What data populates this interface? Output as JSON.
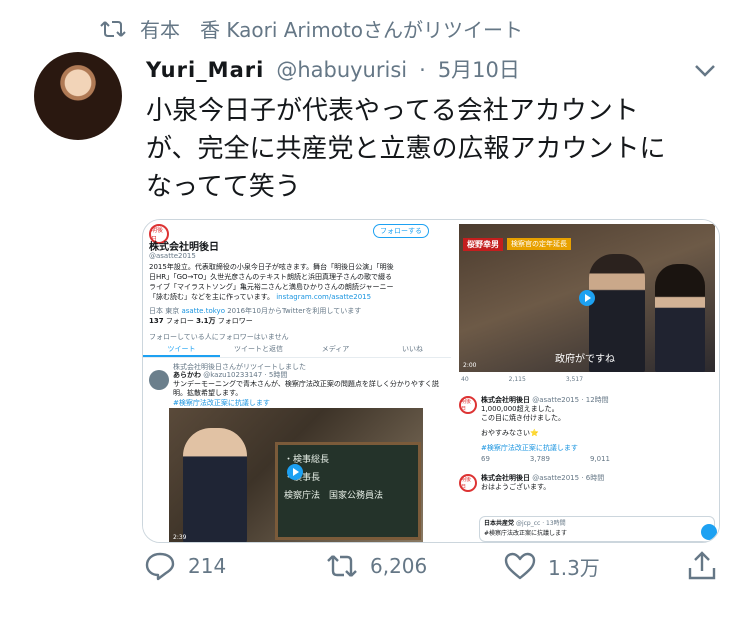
{
  "retweeted_by": "有本　香  Kaori Arimotoさんがリツイート",
  "author": {
    "display_name": "Yuri_Mari",
    "handle": "@habuyurisi",
    "separator": "·",
    "date": "5月10日"
  },
  "tweet_text": "小泉今日子が代表やってる会社アカウント\nが、完全に共産党と立憲の広報アカウントに\nなってて笑う",
  "media": {
    "left": {
      "logo_text": "明後日",
      "follow_label": "フォローする",
      "company_name": "株式会社明後日",
      "company_handle": "@asatte2015",
      "bio": "2015年設立。代表取締役の小泉今日子が呟きます。舞台「明後日公演」「明後日HR」「GO→TO」久世光彦さんのテキスト朗読と浜田真理子さんの歌で綴るライブ「マイラストソング」亀元裕二さんと満島ひかりさんの朗読ジャーニー「詠む読む」などを主に作っています。",
      "bio_link": "instagram.com/asatte2015",
      "location": "日本 東京",
      "site": "asatte.tokyo",
      "joined": "2016年10月からTwitterを利用しています",
      "following_count": "137",
      "following_label": "フォロー",
      "followers_count": "3.1万",
      "followers_label": "フォロワー",
      "no_common": "フォローしている人にフォロワーはいません",
      "tabs": [
        "ツイート",
        "ツイートと返信",
        "メディア",
        "いいね"
      ],
      "rt_note": "株式会社明後日さんがリツイートしました",
      "rt_user": "あらかわ",
      "rt_handle": "@kazu10233147 · 5時間",
      "rt_text": "サンデーモーニングで青木さんが、検察庁法改正案の問題点を詳しく分かりやすく説明。拡散希望します。",
      "rt_tag": "#検察庁法改正案に抗議します",
      "board_line1": "・検事総長",
      "board_line2": "・検事長",
      "board_line3": "検察庁法　国家公務員法",
      "video_time": "2:39"
    },
    "right": {
      "banner_name": "桜野幸男",
      "banner_topic": "検察官の定年延長",
      "caption": "政府がですね",
      "video_time": "2:00",
      "stats": [
        "40",
        "2,115",
        "3,517"
      ],
      "post1_name": "株式会社明後日",
      "post1_handle": "@asatte2015 · 12時間",
      "post1_text1": "1,000,000超えました。",
      "post1_text2": "この目に焼き付けました。",
      "post1_text3": "おやすみなさい⭐",
      "post1_tag": "#検察庁法改正案に抗議します",
      "post1_stats": [
        "69",
        "3,789",
        "9,011"
      ],
      "post2_name": "株式会社明後日",
      "post2_handle": "@asatte2015 · 6時間",
      "post2_text": "おはようございます。",
      "quote_name": "日本共産党",
      "quote_handle": "@jcp_cc · 13時間",
      "quote_text": "#検察庁法改正案に抗議します"
    }
  },
  "actions": {
    "replies": "214",
    "retweets": "6,206",
    "likes": "1.3万"
  },
  "colors": {
    "gray": "#657786",
    "blue": "#1da1f2"
  }
}
